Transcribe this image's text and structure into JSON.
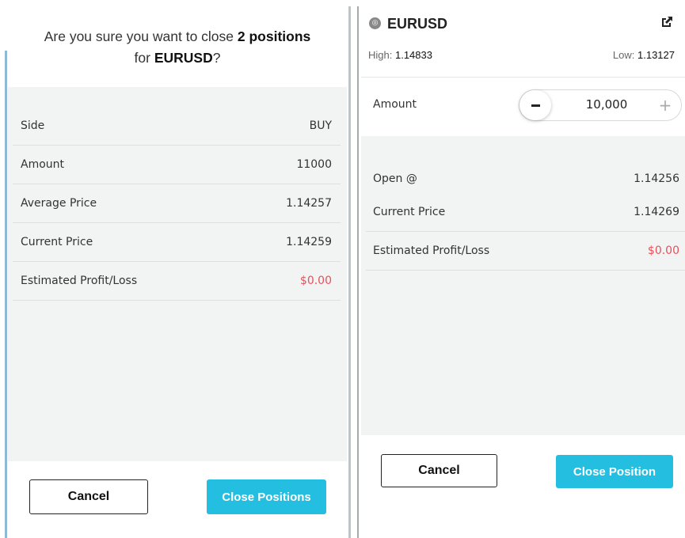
{
  "close_all_dialog": {
    "question_prefix": "Are you sure you want to close",
    "position_count": "2 positions",
    "question_for": "for",
    "symbol": "EURUSD",
    "question_suffix": "?",
    "rows": [
      {
        "label": "Side",
        "value": "BUY"
      },
      {
        "label": "Amount",
        "value": "11000"
      },
      {
        "label": "Average Price",
        "value": "1.14257"
      },
      {
        "label": "Current Price",
        "value": "1.14259"
      },
      {
        "label": "Estimated Profit/Loss",
        "value": "$0.00"
      }
    ],
    "cancel_label": "Cancel",
    "confirm_label": "Close Positions"
  },
  "close_position_panel": {
    "symbol": "EURUSD",
    "symbol_icon": "globe-icon",
    "high_label": "High:",
    "high_value": "1.14833",
    "low_label": "Low:",
    "low_value": "1.13127",
    "amount_label": "Amount",
    "amount_value": "10,000",
    "rows": [
      {
        "label": "Open @",
        "value": "1.14256"
      },
      {
        "label": "Current Price",
        "value": "1.14269"
      },
      {
        "label": "Estimated Profit/Loss",
        "value": "$0.00"
      }
    ],
    "cancel_label": "Cancel",
    "confirm_label": "Close Position"
  },
  "colors": {
    "accent": "#24bfe0",
    "loss_red": "#e8505b",
    "body_gray": "#f2f3f3"
  }
}
